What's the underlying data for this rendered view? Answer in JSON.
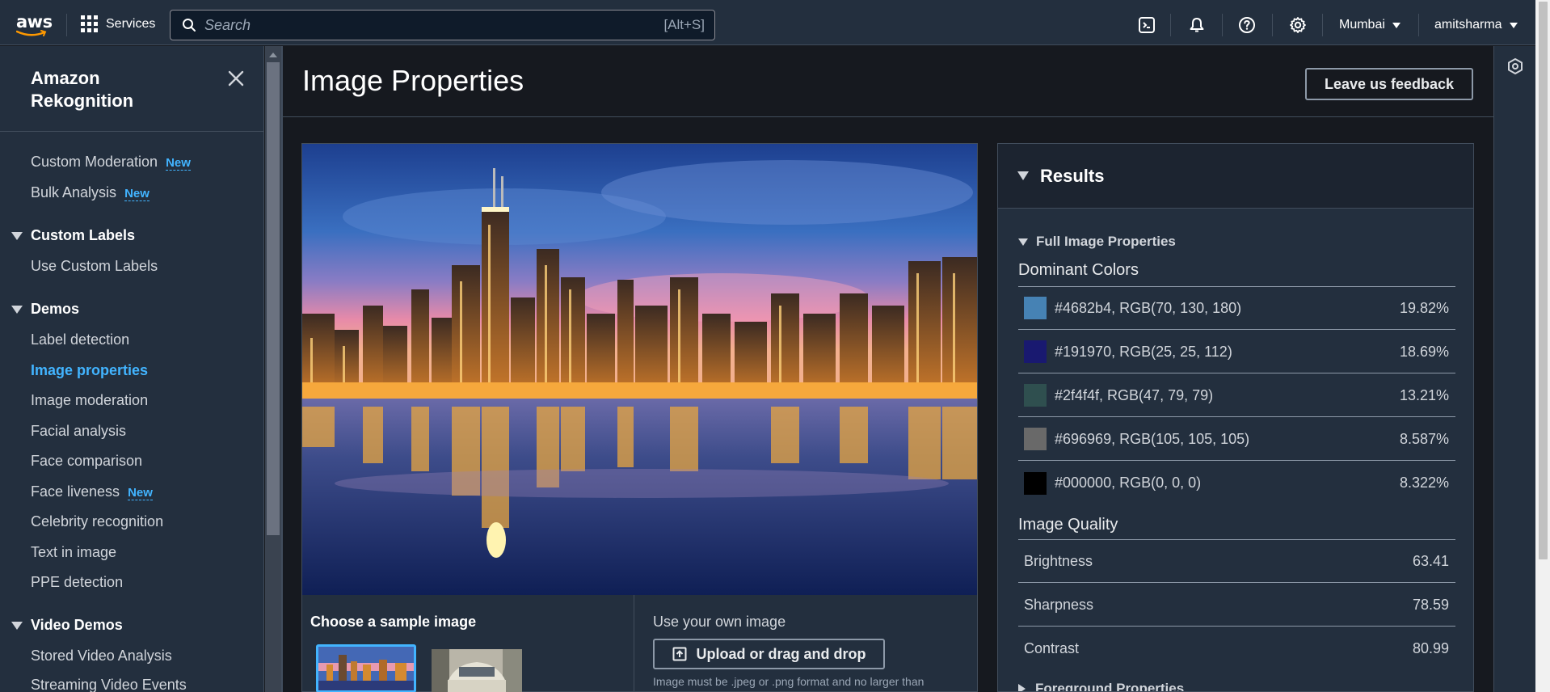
{
  "topnav": {
    "logo": "aws",
    "services_label": "Services",
    "search_placeholder": "Search",
    "search_shortcut": "[Alt+S]",
    "region": "Mumbai",
    "user": "amitsharma",
    "icons": [
      "cloudshell-icon",
      "notifications-bell-icon",
      "help-icon",
      "settings-gear-icon"
    ]
  },
  "sidebar": {
    "title": "Amazon Rekognition",
    "items_top": [
      {
        "label": "Custom Moderation",
        "badge": "New"
      },
      {
        "label": "Bulk Analysis",
        "badge": "New"
      }
    ],
    "sections": [
      {
        "title": "Custom Labels",
        "items": [
          {
            "label": "Use Custom Labels"
          }
        ]
      },
      {
        "title": "Demos",
        "items": [
          {
            "label": "Label detection"
          },
          {
            "label": "Image properties",
            "active": true
          },
          {
            "label": "Image moderation"
          },
          {
            "label": "Facial analysis"
          },
          {
            "label": "Face comparison"
          },
          {
            "label": "Face liveness",
            "badge": "New"
          },
          {
            "label": "Celebrity recognition"
          },
          {
            "label": "Text in image"
          },
          {
            "label": "PPE detection"
          }
        ]
      },
      {
        "title": "Video Demos",
        "items": [
          {
            "label": "Stored Video Analysis"
          },
          {
            "label": "Streaming Video Events"
          }
        ]
      }
    ]
  },
  "main": {
    "title": "Image Properties",
    "feedback_label": "Leave us feedback",
    "sample_title": "Choose a sample image",
    "own_title": "Use your own image",
    "upload_label": "Upload or drag and drop",
    "upload_hint": "Image must be .jpeg or .png format and no larger than"
  },
  "results": {
    "title": "Results",
    "full_props_label": "Full Image Properties",
    "dominant_colors_label": "Dominant Colors",
    "dominant_colors": [
      {
        "label": "#4682b4, RGB(70, 130, 180)",
        "percent": "19.82%",
        "color": "#4682b4"
      },
      {
        "label": "#191970, RGB(25, 25, 112)",
        "percent": "18.69%",
        "color": "#191970"
      },
      {
        "label": "#2f4f4f, RGB(47, 79, 79)",
        "percent": "13.21%",
        "color": "#2f4f4f"
      },
      {
        "label": "#696969, RGB(105, 105, 105)",
        "percent": "8.587%",
        "color": "#696969"
      },
      {
        "label": "#000000, RGB(0, 0, 0)",
        "percent": "8.322%",
        "color": "#000000"
      }
    ],
    "image_quality_label": "Image Quality",
    "image_quality": [
      {
        "label": "Brightness",
        "value": "63.41"
      },
      {
        "label": "Sharpness",
        "value": "78.59"
      },
      {
        "label": "Contrast",
        "value": "80.99"
      }
    ],
    "foreground_label": "Foreground Properties"
  },
  "colors": {
    "accent": "#42b4ff",
    "nav_bg": "#232f3e",
    "page_bg": "#16191f"
  }
}
